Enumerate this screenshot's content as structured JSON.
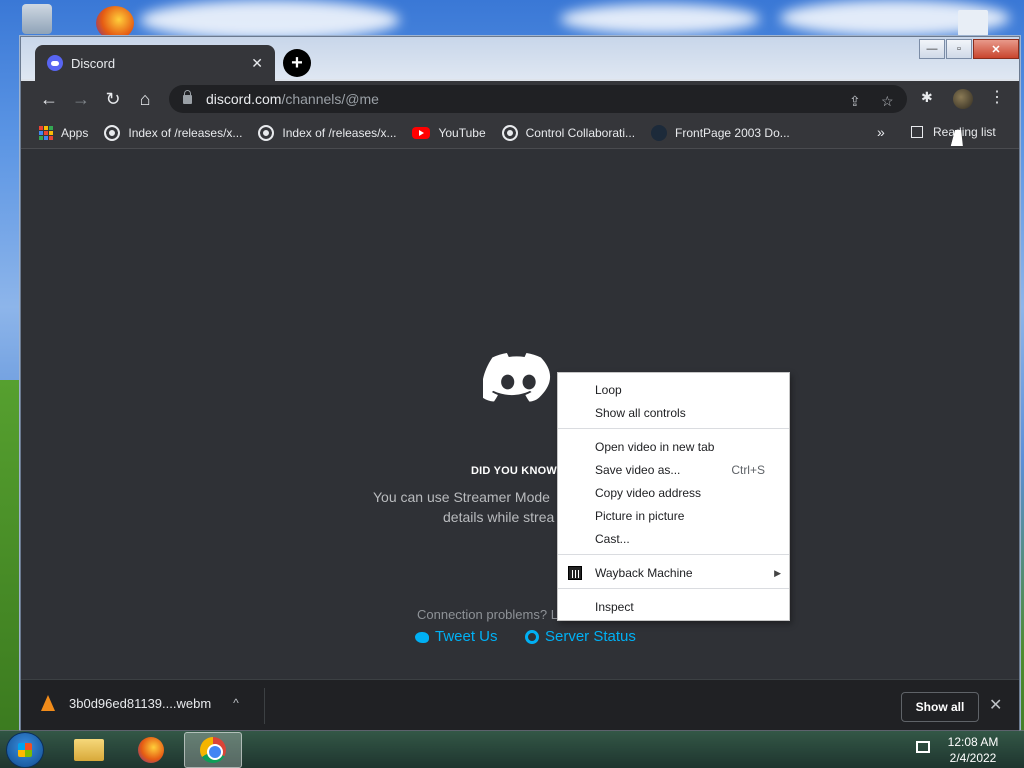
{
  "tab": {
    "title": "Discord",
    "close": "✕"
  },
  "newtab": "+",
  "window_controls": {
    "minimize": "—",
    "maximize": "▫",
    "close": "✕"
  },
  "nav": {
    "back": "←",
    "forward": "→",
    "reload": "↻",
    "home": "⌂"
  },
  "omnibox": {
    "domain": "discord.com",
    "path": "/channels/@me"
  },
  "omni_icons": {
    "share": "⇪",
    "star": "☆",
    "extensions": "✱",
    "menu": "⋮"
  },
  "bookmarks": [
    {
      "label": "Apps",
      "icon": "apps-grid-icon"
    },
    {
      "label": "Index of /releases/x...",
      "icon": "globe-icon"
    },
    {
      "label": "Index of /releases/x...",
      "icon": "globe-icon"
    },
    {
      "label": "YouTube",
      "icon": "youtube-icon"
    },
    {
      "label": "Control Collaborati...",
      "icon": "globe-icon"
    },
    {
      "label": "FrontPage 2003 Do...",
      "icon": "frontpage-icon"
    }
  ],
  "bookmarks_more": "»",
  "reading_list": "Reading list",
  "discord": {
    "did_you_know": "DID YOU KNOW",
    "tip_line1": "You can use Streamer Mode",
    "tip_line2": "details while strea",
    "connection": "Connection problems? L",
    "tweet": "Tweet Us",
    "server_status": "Server Status"
  },
  "context_menu": {
    "loop": "Loop",
    "show_controls": "Show all controls",
    "open_new_tab": "Open video in new tab",
    "save_video": "Save video as...",
    "save_shortcut": "Ctrl+S",
    "copy_address": "Copy video address",
    "pip": "Picture in picture",
    "cast": "Cast...",
    "wayback": "Wayback Machine",
    "wayback_arrow": "▶",
    "inspect": "Inspect"
  },
  "download": {
    "filename": "3b0d96ed81139....webm",
    "chevron": "^",
    "show_all": "Show all",
    "close": "✕"
  },
  "clock": {
    "time": "12:08 AM",
    "date": "2/4/2022"
  },
  "colors": {
    "discord_bg": "#2f3136",
    "chrome_dark": "#35363a",
    "link": "#00b0f4",
    "blurple": "#5865f2"
  }
}
